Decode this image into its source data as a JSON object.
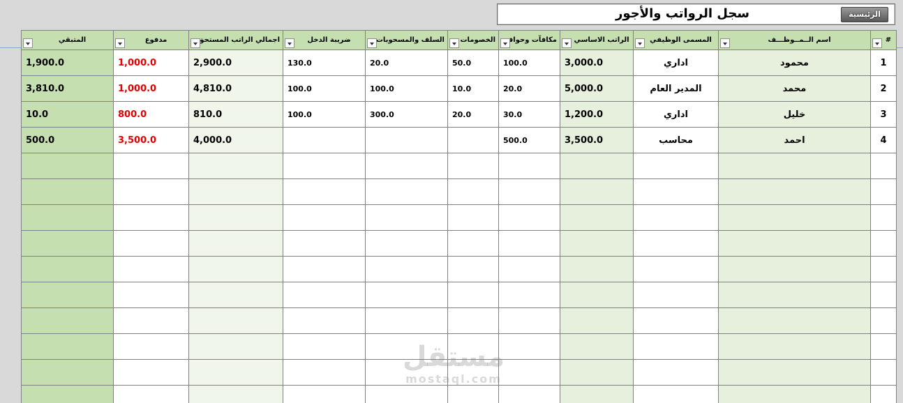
{
  "title": "سجل الرواتب والأجور",
  "home_button": "الرئيسية",
  "columns": {
    "idx": "#",
    "name": "اسم الــمــوظـــف",
    "job": "المسمى الوظيفي",
    "basic": "الراتب الاساسي",
    "bonus": "مكافآت وحوافز",
    "deductions": "الخصومات",
    "advances": "السلف والمسحوبات",
    "tax": "ضريبة الدخل",
    "total": "اجمالي الراتب المستحق",
    "paid": "مدفوع",
    "remaining": "المتبقي"
  },
  "rows": [
    {
      "idx": "1",
      "name": "محمود",
      "job": "اداري",
      "basic": "3,000.0",
      "bonus": "100.0",
      "deductions": "50.0",
      "advances": "20.0",
      "tax": "130.0",
      "total": "2,900.0",
      "paid": "1,000.0",
      "remaining": "1,900.0"
    },
    {
      "idx": "2",
      "name": "محمد",
      "job": "المدير العام",
      "basic": "5,000.0",
      "bonus": "20.0",
      "deductions": "10.0",
      "advances": "100.0",
      "tax": "100.0",
      "total": "4,810.0",
      "paid": "1,000.0",
      "remaining": "3,810.0"
    },
    {
      "idx": "3",
      "name": "خليل",
      "job": "اداري",
      "basic": "1,200.0",
      "bonus": "30.0",
      "deductions": "20.0",
      "advances": "300.0",
      "tax": "100.0",
      "total": "810.0",
      "paid": "800.0",
      "remaining": "10.0"
    },
    {
      "idx": "4",
      "name": "احمد",
      "job": "محاسب",
      "basic": "3,500.0",
      "bonus": "500.0",
      "deductions": "",
      "advances": "",
      "tax": "",
      "total": "4,000.0",
      "paid": "3,500.0",
      "remaining": "500.0"
    }
  ],
  "empty_rows": 10,
  "watermark": {
    "arabic": "مستقل",
    "latin": "mostaql.com"
  },
  "colors": {
    "header_green": "#c6dfb1",
    "light_green": "#e7f0dd",
    "paid_red": "#e60000"
  }
}
